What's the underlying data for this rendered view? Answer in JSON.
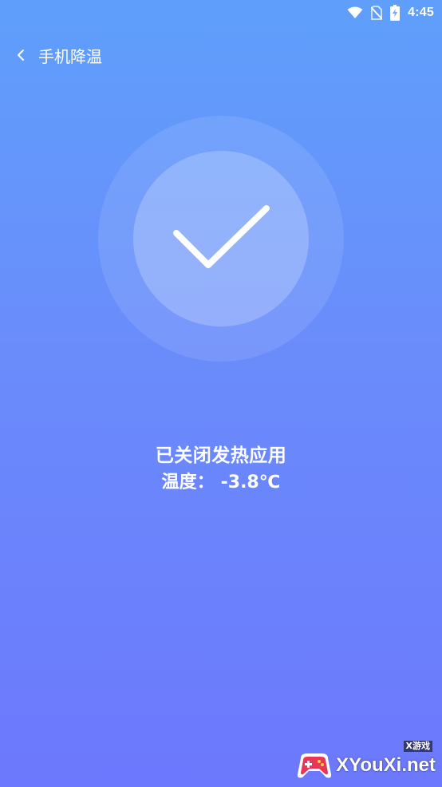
{
  "status_bar": {
    "time": "4:45",
    "icons": [
      "wifi-icon",
      "no-sim-icon",
      "battery-charging-icon"
    ]
  },
  "header": {
    "back_icon": "chevron-left-icon",
    "title": "手机降温"
  },
  "status_circle": {
    "icon": "checkmark-icon"
  },
  "result": {
    "title": "已关闭发热应用",
    "temperature_label": "温度：",
    "temperature_value": "-3.8℃"
  },
  "watermark": {
    "tag": "X游戏",
    "text": "XYouXi.net",
    "logo": "gamepad-logo"
  },
  "colors": {
    "background_top": "#5f9ffb",
    "background_bottom": "#6c78fd",
    "foreground": "#ffffff"
  }
}
